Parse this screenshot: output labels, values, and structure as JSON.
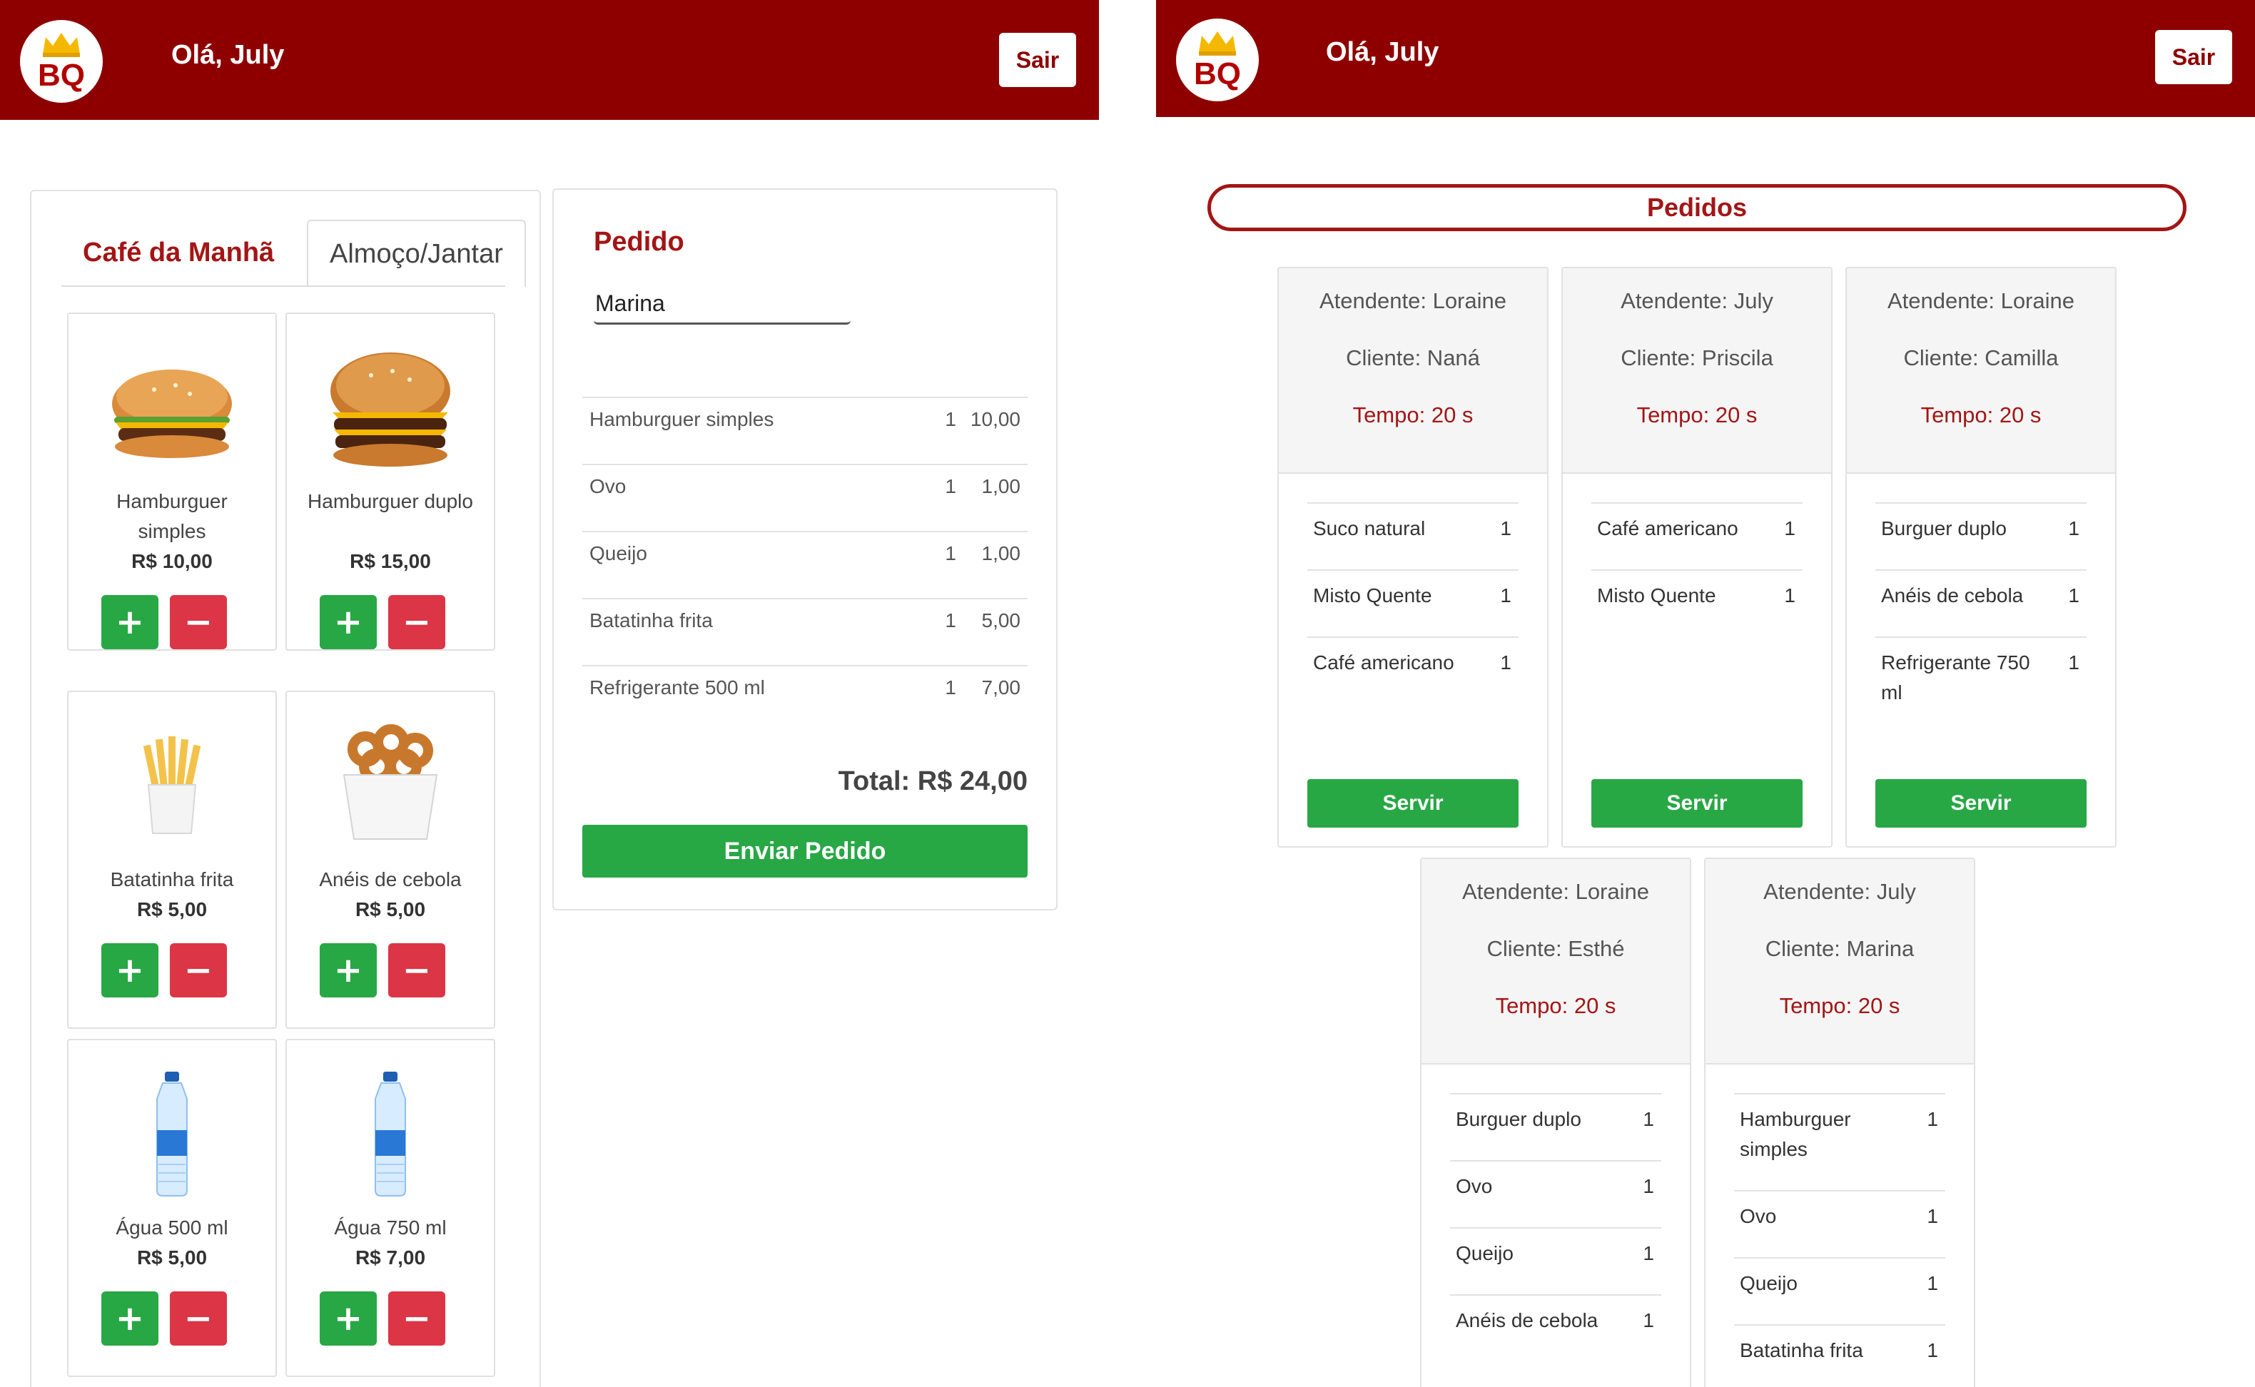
{
  "brand": {
    "logo_text": "BQ",
    "primary_color": "#8e0000",
    "accent_red": "#a31515",
    "success_green": "#28a745",
    "danger_red": "#dc3545"
  },
  "left_screen": {
    "header": {
      "greeting": "Olá, July",
      "logout_label": "Sair"
    },
    "menu": {
      "tabs": [
        {
          "label": "Café da Manhã",
          "active": true
        },
        {
          "label": "Almoço/Jantar",
          "active": false
        }
      ],
      "products": [
        {
          "name": "Hamburguer simples",
          "price": "R$ 10,00",
          "icon": "burger-simple-image"
        },
        {
          "name": "Hamburguer duplo",
          "price": "R$ 15,00",
          "icon": "burger-double-image"
        },
        {
          "name": "Batatinha frita",
          "price": "R$ 5,00",
          "icon": "fries-image"
        },
        {
          "name": "Anéis de cebola",
          "price": "R$ 5,00",
          "icon": "onion-rings-image"
        },
        {
          "name": "Água 500 ml",
          "price": "R$ 5,00",
          "icon": "water-bottle-image"
        },
        {
          "name": "Água 750 ml",
          "price": "R$ 7,00",
          "icon": "water-bottle-image"
        }
      ],
      "plus_symbol": "+",
      "minus_symbol": "−"
    },
    "order": {
      "title": "Pedido",
      "client_name": "Marina",
      "items": [
        {
          "name": "Hamburguer simples",
          "qty": "1",
          "price": "10,00"
        },
        {
          "name": "Ovo",
          "qty": "1",
          "price": "1,00"
        },
        {
          "name": "Queijo",
          "qty": "1",
          "price": "1,00"
        },
        {
          "name": "Batatinha frita",
          "qty": "1",
          "price": "5,00"
        },
        {
          "name": "Refrigerante 500 ml",
          "qty": "1",
          "price": "7,00"
        }
      ],
      "total": "Total: R$ 24,00",
      "send_label": "Enviar Pedido"
    }
  },
  "right_screen": {
    "header": {
      "greeting": "Olá, July",
      "logout_label": "Sair"
    },
    "title": "Pedidos",
    "orders": [
      {
        "attendant": "Atendente: Loraine",
        "client": "Cliente: Naná",
        "time": "Tempo: 20 s",
        "items": [
          {
            "name": "Suco natural",
            "qty": "1"
          },
          {
            "name": "Misto Quente",
            "qty": "1"
          },
          {
            "name": "Café americano",
            "qty": "1"
          }
        ],
        "serve_label": "Servir"
      },
      {
        "attendant": "Atendente: July",
        "client": "Cliente: Priscila",
        "time": "Tempo: 20 s",
        "items": [
          {
            "name": "Café americano",
            "qty": "1"
          },
          {
            "name": "Misto Quente",
            "qty": "1"
          }
        ],
        "serve_label": "Servir"
      },
      {
        "attendant": "Atendente: Loraine",
        "client": "Cliente: Camilla",
        "time": "Tempo: 20 s",
        "items": [
          {
            "name": "Burguer duplo",
            "qty": "1"
          },
          {
            "name": "Anéis de cebola",
            "qty": "1"
          },
          {
            "name": "Refrigerante 750 ml",
            "qty": "1"
          }
        ],
        "serve_label": "Servir"
      },
      {
        "attendant": "Atendente: Loraine",
        "client": "Cliente: Esthé",
        "time": "Tempo: 20 s",
        "items": [
          {
            "name": "Burguer duplo",
            "qty": "1"
          },
          {
            "name": "Ovo",
            "qty": "1"
          },
          {
            "name": "Queijo",
            "qty": "1"
          },
          {
            "name": "Anéis de cebola",
            "qty": "1"
          }
        ]
      },
      {
        "attendant": "Atendente: July",
        "client": "Cliente: Marina",
        "time": "Tempo: 20 s",
        "items": [
          {
            "name": "Hamburguer simples",
            "qty": "1"
          },
          {
            "name": "Ovo",
            "qty": "1"
          },
          {
            "name": "Queijo",
            "qty": "1"
          },
          {
            "name": "Batatinha frita",
            "qty": "1"
          }
        ]
      }
    ]
  }
}
